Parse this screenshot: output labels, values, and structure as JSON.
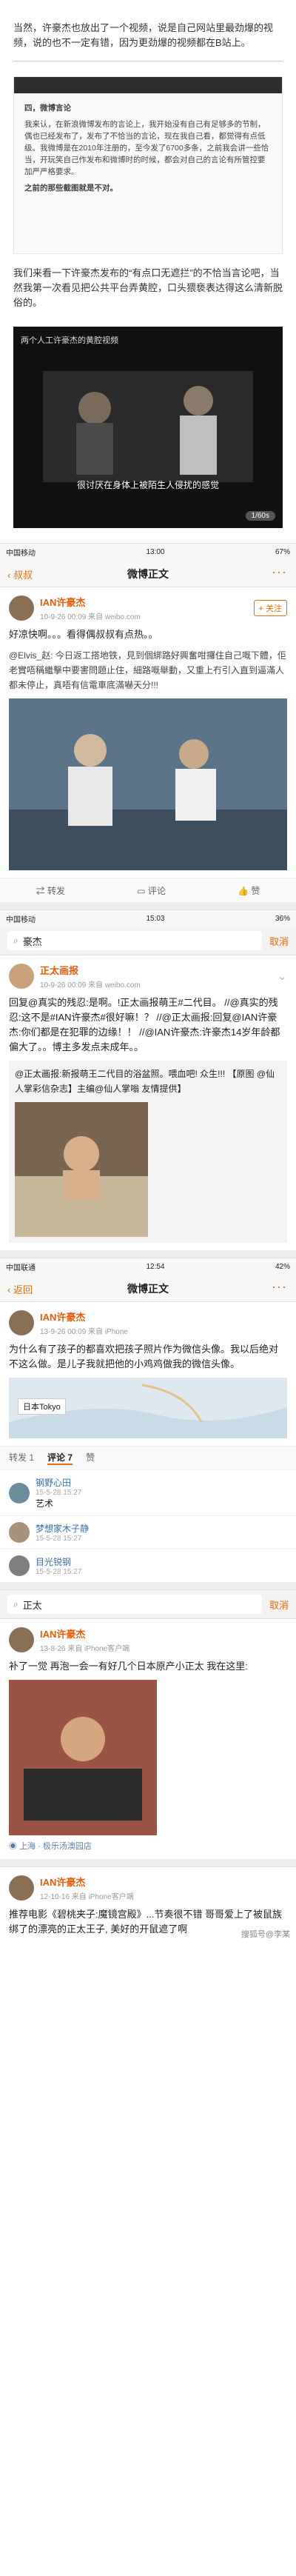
{
  "intro": {
    "text": "当然，许豪杰也放出了一个视频，说是自己网站里最劲爆的视频，说的也不一定有错，因为更劲爆的视频都在B站上。"
  },
  "doc": {
    "header": "四，微博言论",
    "body": "我来认，在新浪微博发布的言论上，我开始没有自己有足够多的节制，偶也已经发布了，发布了不恰当的言论，现在我自己看，都觉得有点低级。我微博是在2010年注册的，至今发了6700多条，之前我会讲一些恰当，开玩笑自己作发布和微博时的时候，都会对自己的言论有所管控要加严严格要求。",
    "tail": "之前的那些截图就是不对。"
  },
  "para2": {
    "text": "我们来看一下许豪杰发布的“有点口无遮拦”的不恰当言论吧，当然我第一次看见把公共平台弄黄腔，口头猥亵表达得这么清新脱俗的。"
  },
  "video": {
    "title": "两个人工许豪杰的黄腔视频",
    "subtitle": "很讨厌在身体上被陌生人侵扰的感觉",
    "pill": "1/60s"
  },
  "screen1": {
    "status_left": "中国移动",
    "status_time": "13:00",
    "status_right": "67%",
    "back": "叔叔",
    "title": "微博正文",
    "user": "IAN许豪杰",
    "meta": "10-9-26 00:09 来自 weibo.com",
    "follow": "+ 关注",
    "text": "好凉快啊。。。看得偶叔叔有点热。。",
    "actions": [
      "转发",
      "评论",
      "赞"
    ]
  },
  "post2": {
    "text1": "@Elvis_赵: 今日返工搭地铁，見到個綁路好興奮咁攞住自己嘅下體，佢老實唔稱繼擊中要害問題止住，細路嘅舉動，又重上冇引入直到逼滿人都未停止，真唔有信電車底滿嚇天分!!!"
  },
  "screen2": {
    "status_left": "中国移动",
    "status_time": "15:03",
    "status_right": "36%",
    "search_value": "豪杰",
    "cancel": "取消",
    "user": "正太画报",
    "meta": "10-9-26 00:09 来自 weibo.com",
    "text": "回复@真实的残忍:是啊。!正太画报萌王#二代目。 //@真实的残忍:这不是#IAN许豪杰#很好嘛！？ //@正太画报:回复@IAN许豪杰:你们都是在犯罪的边缘！！ //@IAN许豪杰:许豪杰14岁年龄都偏大了。。博主多发点未成年。。",
    "quote": "@正太画报:新报萌王二代目的浴盆照。喂血吧! 众生!!! 【原图 @仙人掌彩信杂志】主编@仙人掌嗡 友情提供】"
  },
  "screen3": {
    "status_left": "中国联通",
    "status_time": "12:54",
    "status_right": "42%",
    "back": "返回",
    "title": "微博正文",
    "user": "IAN许豪杰",
    "meta": "13-9-26 00:09 来自 iPhone",
    "text": "为什么有了孩子的都喜欢把孩子照片作为微信头像。我以后绝对不这么做。是儿子我就把他的小鸡鸡做我的微信头像。",
    "map_label": "日本Tokyo",
    "tabs": [
      "转发 1",
      "评论 7",
      "赞"
    ],
    "comments": [
      {
        "name": "钢野心田",
        "time": "15-5-28 15:27",
        "text": "艺术"
      },
      {
        "name": "梦想家木子静",
        "time": "15-5-28 15:27",
        "text": ""
      },
      {
        "name": "目光锐钢",
        "time": "15-5-28 15:27",
        "text": ""
      }
    ]
  },
  "screen4": {
    "search_value": "正太",
    "cancel": "取消",
    "user": "IAN许豪杰",
    "meta": "13-8-26 来自 iPhone客户端",
    "text": "补了一觉  再泡一会一有好几个日本原产小正太  我在这里:",
    "location": "上海 · 极乐汤澳园店"
  },
  "screen5": {
    "user": "IAN许豪杰",
    "meta": "12-10-16 来自 iPhone客户端",
    "text": "推荐电影《碧桃夹子:魔镜宫殿》...节奏很不错 哥哥爱上了被鼠族绑了的漂亮的正太王子, 美好的开鼠遮了啊",
    "watermark": "搜狐号@李某"
  },
  "colors": {
    "accent": "#e86c0c",
    "link": "#3b6db3"
  }
}
